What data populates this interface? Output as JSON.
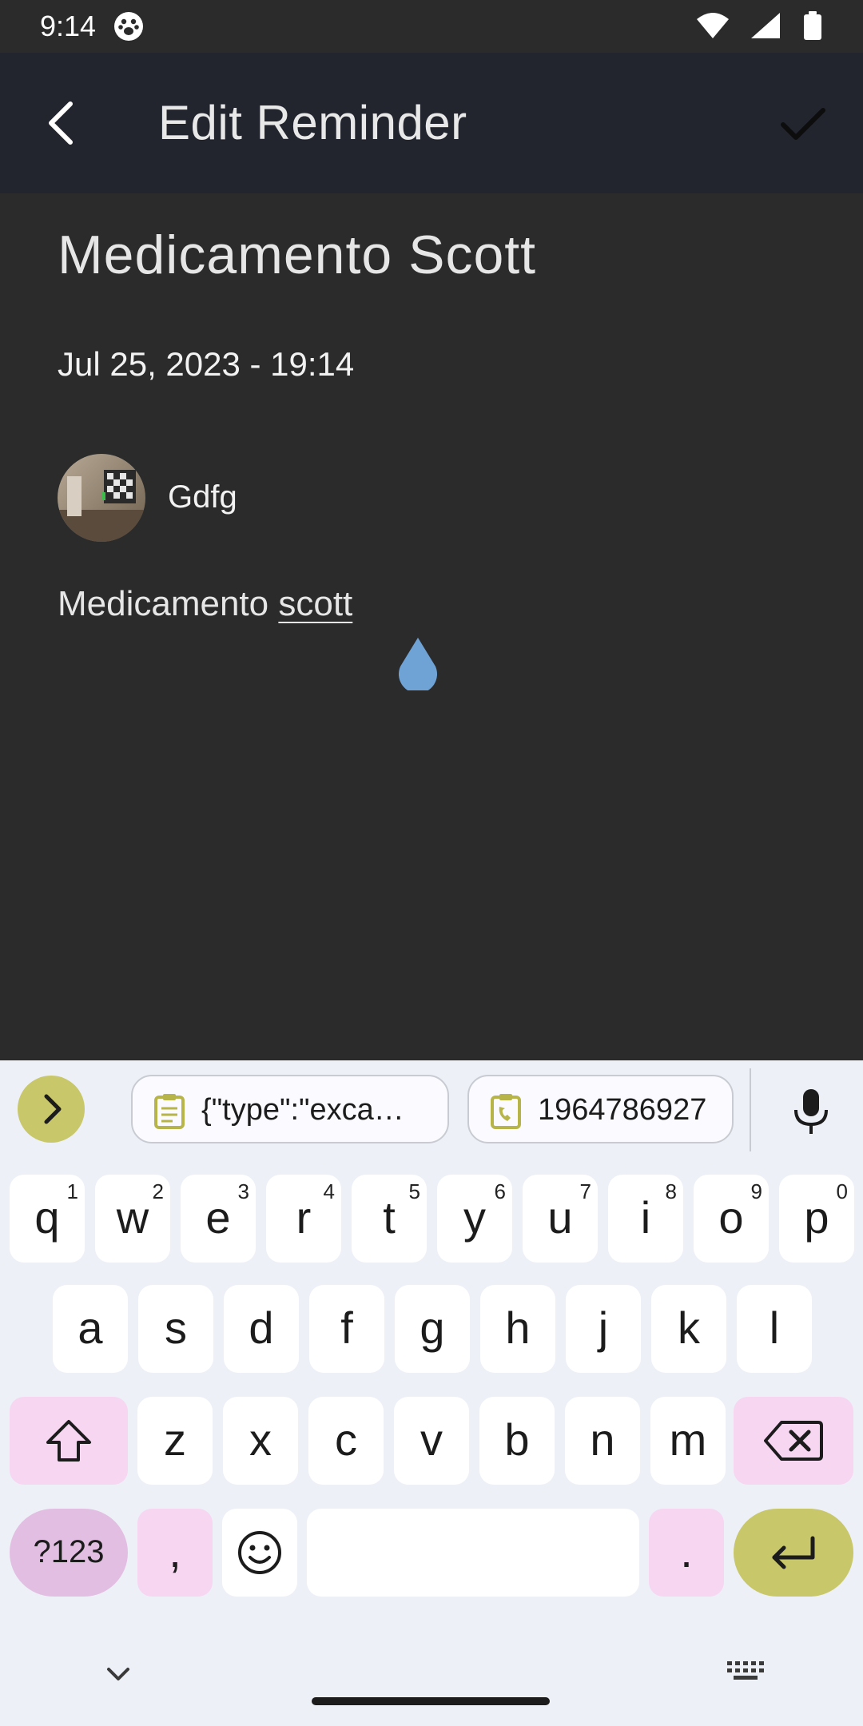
{
  "status_bar": {
    "time": "9:14",
    "icons": [
      "paw-icon",
      "wifi-icon",
      "signal-icon",
      "battery-icon"
    ]
  },
  "app_bar": {
    "title": "Edit Reminder",
    "back_icon": "back-arrow-icon",
    "confirm_icon": "check-icon"
  },
  "reminder": {
    "title": "Medicamento Scott",
    "datetime": "Jul 25, 2023 - 19:14",
    "contact_name": "Gdfg",
    "note_prefix": "Medicamento ",
    "note_word": "scott"
  },
  "keyboard": {
    "clipboard": [
      {
        "text": "{\"type\":\"exca…",
        "icon": "clipboard-icon"
      },
      {
        "text": "1964786927",
        "icon": "clipboard-phone-icon"
      }
    ],
    "row1": [
      {
        "k": "q",
        "h": "1"
      },
      {
        "k": "w",
        "h": "2"
      },
      {
        "k": "e",
        "h": "3"
      },
      {
        "k": "r",
        "h": "4"
      },
      {
        "k": "t",
        "h": "5"
      },
      {
        "k": "y",
        "h": "6"
      },
      {
        "k": "u",
        "h": "7"
      },
      {
        "k": "i",
        "h": "8"
      },
      {
        "k": "o",
        "h": "9"
      },
      {
        "k": "p",
        "h": "0"
      }
    ],
    "row2": [
      "a",
      "s",
      "d",
      "f",
      "g",
      "h",
      "j",
      "k",
      "l"
    ],
    "row3": [
      "z",
      "x",
      "c",
      "v",
      "b",
      "n",
      "m"
    ],
    "symbols_label": "?123",
    "comma": ",",
    "period": ".",
    "icons": [
      "chevron-right-icon",
      "mic-icon",
      "shift-icon",
      "backspace-icon",
      "emoji-icon",
      "enter-icon",
      "chevron-down-icon",
      "keyboard-icon"
    ]
  },
  "colors": {
    "app_bar": "#22252e",
    "background": "#2b2b2b",
    "keyboard": "#eef0f8",
    "accent": "#c8c76a",
    "modifier": "#f6d6f1",
    "cursor_handle": "#6fa3d6"
  }
}
